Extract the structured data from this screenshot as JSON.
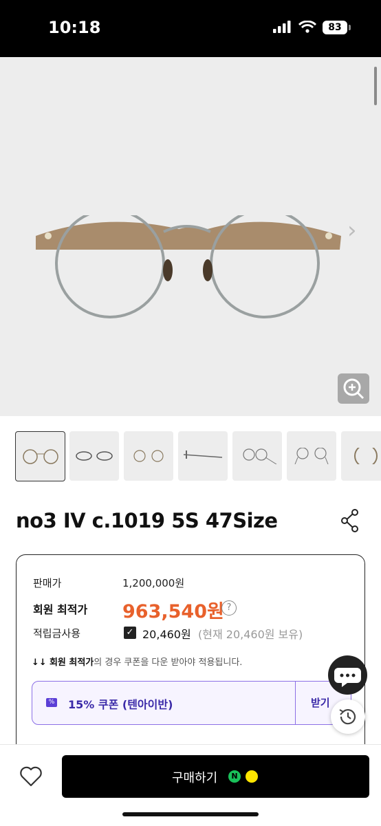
{
  "status_bar": {
    "time": "10:18",
    "battery": "83"
  },
  "product": {
    "title": "no3 IV c.1019 5S 47Size",
    "thumbnail_count": 7
  },
  "price": {
    "list_label": "판매가",
    "list_price": "1,200,000원",
    "member_label": "회원 최적가",
    "member_price": "963,540원",
    "points_label": "적립금사용",
    "points_value": "20,460원",
    "points_note": "(현재 20,460원 보유)",
    "notice_bold": "회원 최적가",
    "notice_rest": "의 경우 쿠폰을 다운 받아야 적용됩니다.",
    "notice_arrows": "↓↓"
  },
  "coupon": {
    "label": "15% 쿠폰 (텐아이반)",
    "receive_label": "받기"
  },
  "bottom": {
    "buy_label": "구매하기"
  },
  "colors": {
    "accent_orange": "#e8612c",
    "coupon_purple": "#5b3fd6",
    "naver_green": "#19c15a",
    "kakao_yellow": "#fee500"
  },
  "icons": [
    "signal-icon",
    "wifi-icon",
    "battery-icon",
    "chevron-right-icon",
    "zoom-in-icon",
    "share-icon",
    "help-icon",
    "check-icon",
    "coupon-icon",
    "chat-icon",
    "history-icon",
    "heart-icon",
    "naver-pay-icon",
    "kakao-pay-icon"
  ]
}
